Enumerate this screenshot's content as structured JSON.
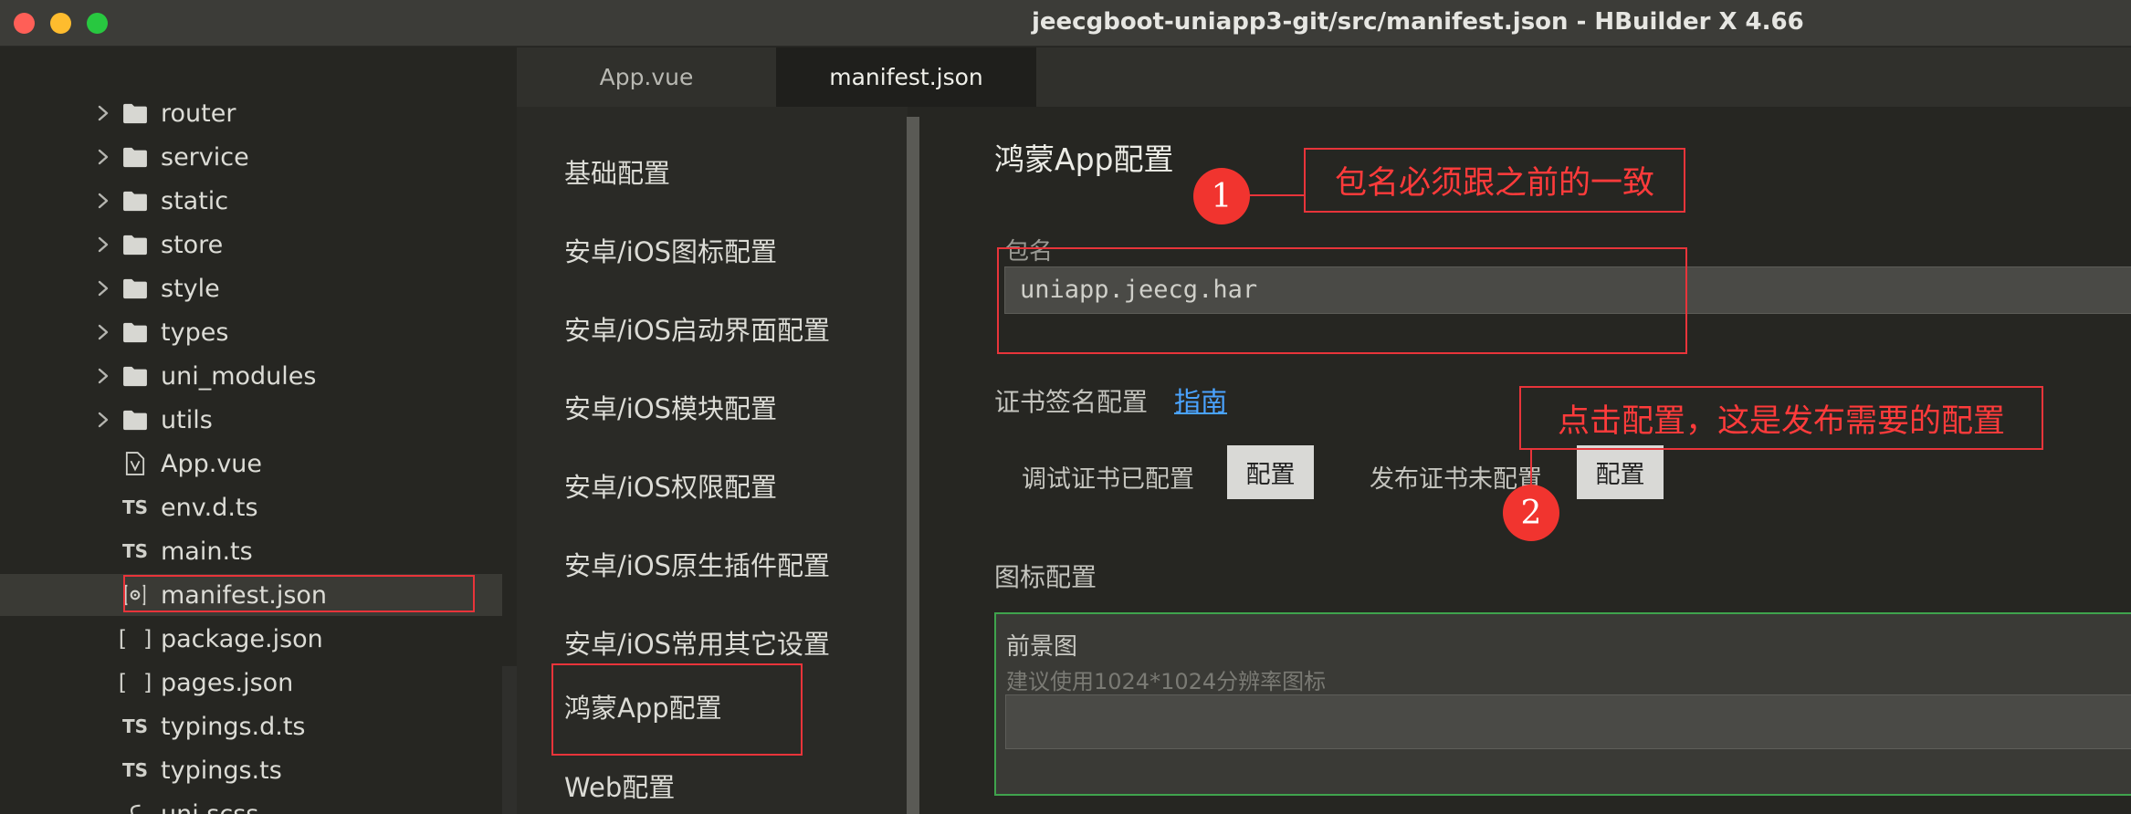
{
  "window": {
    "title": "jeecgboot-uniapp3-git/src/manifest.json - HBuilder X 4.66"
  },
  "sidebar": {
    "items": [
      {
        "label": "router",
        "kind": "folder"
      },
      {
        "label": "service",
        "kind": "folder"
      },
      {
        "label": "static",
        "kind": "folder"
      },
      {
        "label": "store",
        "kind": "folder"
      },
      {
        "label": "style",
        "kind": "folder"
      },
      {
        "label": "types",
        "kind": "folder"
      },
      {
        "label": "uni_modules",
        "kind": "folder"
      },
      {
        "label": "utils",
        "kind": "folder"
      },
      {
        "label": "App.vue",
        "kind": "vue"
      },
      {
        "label": "env.d.ts",
        "kind": "ts",
        "icon_text": "TS"
      },
      {
        "label": "main.ts",
        "kind": "ts",
        "icon_text": "TS"
      },
      {
        "label": "manifest.json",
        "kind": "settings",
        "selected": true
      },
      {
        "label": "package.json",
        "kind": "json",
        "icon_text": "[ ]"
      },
      {
        "label": "pages.json",
        "kind": "json",
        "icon_text": "[ ]"
      },
      {
        "label": "typings.d.ts",
        "kind": "ts",
        "icon_text": "TS"
      },
      {
        "label": "typings.ts",
        "kind": "ts",
        "icon_text": "TS"
      },
      {
        "label": "uni.scss",
        "kind": "scss"
      }
    ]
  },
  "tabs": [
    {
      "label": "App.vue",
      "active": false
    },
    {
      "label": "manifest.json",
      "active": true
    }
  ],
  "config_nav": {
    "items": [
      {
        "label": "基础配置"
      },
      {
        "label": "安卓/iOS图标配置"
      },
      {
        "label": "安卓/iOS启动界面配置"
      },
      {
        "label": "安卓/iOS模块配置"
      },
      {
        "label": "安卓/iOS权限配置"
      },
      {
        "label": "安卓/iOS原生插件配置"
      },
      {
        "label": "安卓/iOS常用其它设置"
      },
      {
        "label": "鸿蒙App配置",
        "active": true
      },
      {
        "label": "Web配置"
      }
    ]
  },
  "content": {
    "title": "鸿蒙App配置",
    "package_label": "包名",
    "package_value": "uniapp.jeecg.har",
    "cert_section_title": "证书签名配置",
    "guide_link": "指南",
    "debug_cert_status": "调试证书已配置",
    "debug_cert_button": "配置",
    "release_cert_status": "发布证书未配置",
    "release_cert_button": "配置",
    "icon_section_title": "图标配置",
    "foreground_label": "前景图",
    "foreground_hint": "建议使用1024*1024分辨率图标",
    "foreground_value": ""
  },
  "annotations": {
    "note1": "包名必须跟之前的一致",
    "note2": "点击配置，这是发布需要的配置",
    "badge1": "1",
    "badge2": "2"
  },
  "colors": {
    "annotation_red": "#e8343a",
    "link_blue": "#4aa3ff",
    "icon_box_green": "#3fa34d"
  }
}
